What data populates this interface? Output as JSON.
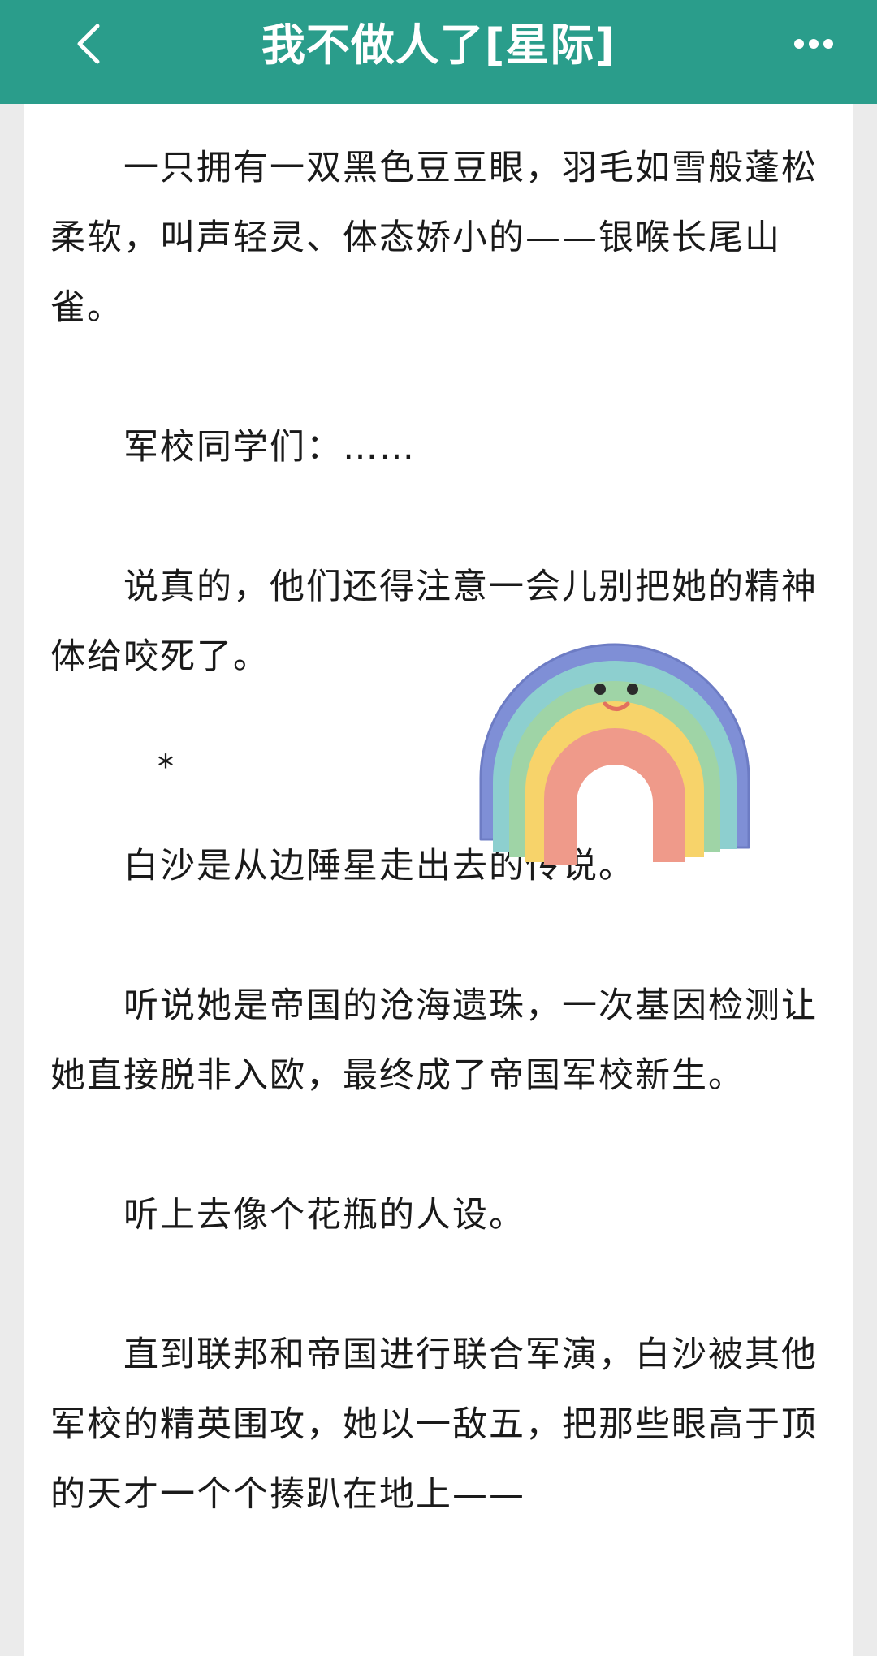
{
  "header": {
    "title": "我不做人了[星际]",
    "back_icon": "chevron-left-icon",
    "more_icon": "more-dots-icon",
    "background": "#2a9d8b"
  },
  "content": {
    "paragraphs": [
      "一只拥有一双黑色豆豆眼，羽毛如雪般蓬松柔软，叫声轻灵、体态娇小的——银喉长尾山雀。",
      "军校同学们：……",
      "说真的，他们还得注意一会儿别把她的精神体给咬死了。",
      "*",
      "白沙是从边陲星走出去的传说。",
      "听说她是帝国的沧海遗珠，一次基因检测让她直接脱非入欧，最终成了帝国军校新生。",
      "听上去像个花瓶的人设。",
      "直到联邦和帝国进行联合军演，白沙被其他军校的精英围攻，她以一敌五，把那些眼高于顶的天才一个个揍趴在地上——"
    ]
  },
  "sticker": {
    "icon": "rainbow-sticker-icon"
  }
}
